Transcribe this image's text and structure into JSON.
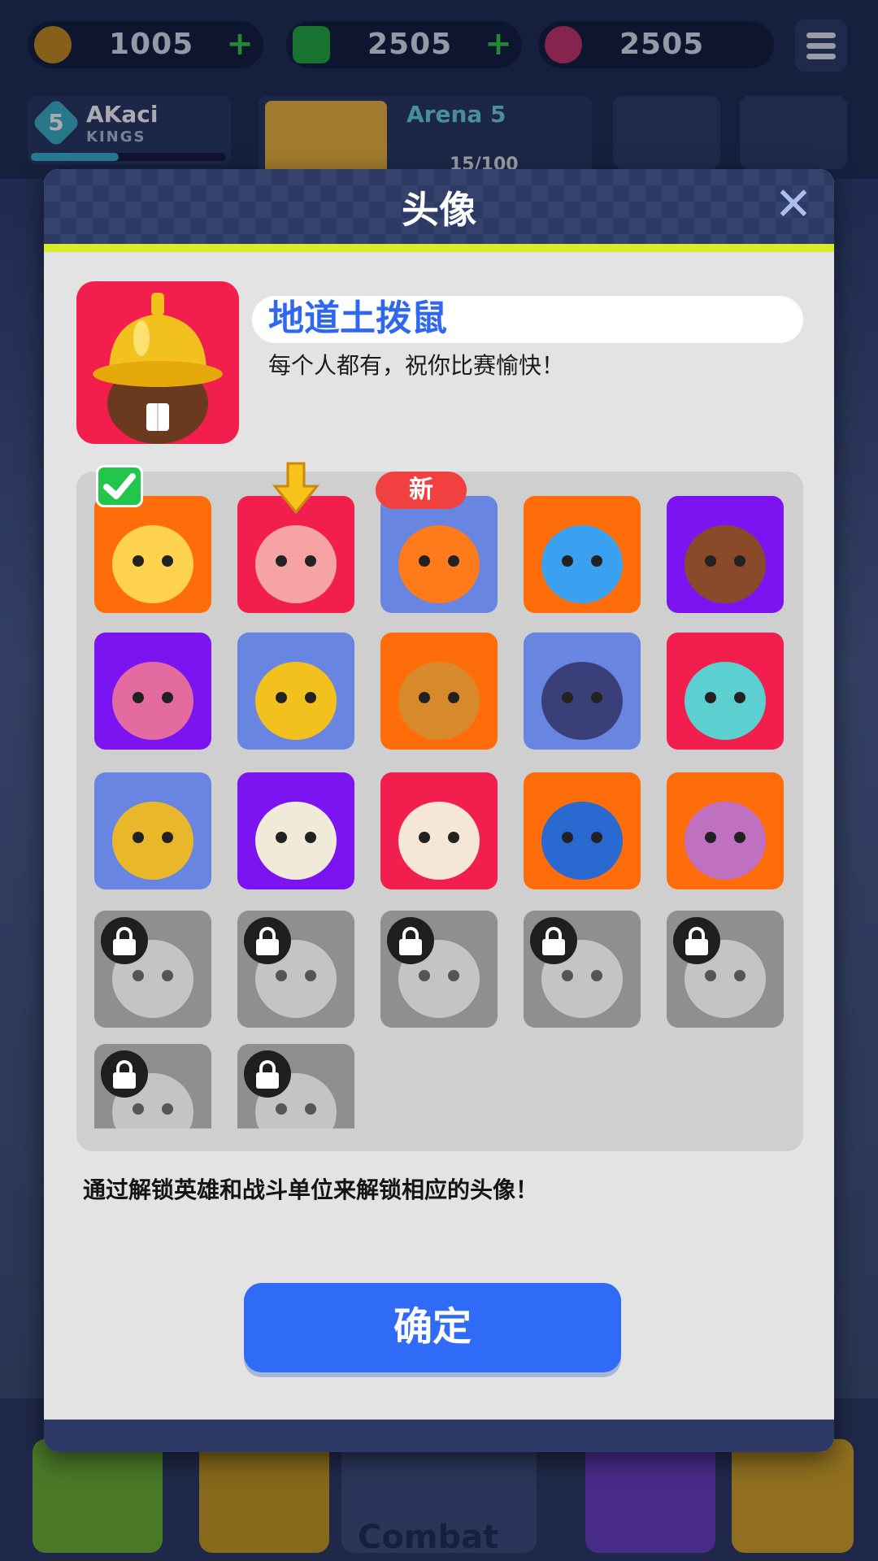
{
  "resources": {
    "coins": "1005",
    "gems": "2505",
    "tokens": "2505",
    "coin_icon": "coin-icon",
    "gem_icon": "gem-icon",
    "token_icon": "flower-token-icon"
  },
  "player": {
    "level": "5",
    "name": "AKaci",
    "subtitle": "KINGS",
    "xp_fraction": 0.45
  },
  "arena": {
    "title": "Arena 5",
    "progress": "15/100"
  },
  "bottom_nav": {
    "combat_label": "Combat"
  },
  "modal": {
    "title": "头像",
    "close_icon": "close-icon",
    "selected_name": "地道土拨鼠",
    "selected_subtitle": "每个人都有，祝你比赛愉快！",
    "new_badge": "新",
    "hint": "通过解锁英雄和战斗单位来解锁相应的头像！",
    "confirm_label": "确定",
    "colors": {
      "orange": "#ff6d0b",
      "pink": "#f11e4e",
      "blue": "#6785e1",
      "purple": "#7c14f1",
      "locked": "#8f8f8f",
      "accent": "#d9ec2a",
      "button": "#2f6bf6"
    },
    "avatars": [
      {
        "icon": "eagle-avatar-icon",
        "bg": "orange",
        "state": "equipped"
      },
      {
        "icon": "pig-pilot-avatar-icon",
        "bg": "pink",
        "state": "highlighted"
      },
      {
        "icon": "fox-avatar-icon",
        "bg": "blue",
        "state": "new"
      },
      {
        "icon": "blue-hat-avatar-icon",
        "bg": "orange",
        "state": "unlocked"
      },
      {
        "icon": "doberman-avatar-icon",
        "bg": "purple",
        "state": "unlocked"
      },
      {
        "icon": "pink-bunny-avatar-icon",
        "bg": "purple",
        "state": "unlocked"
      },
      {
        "icon": "chick-helmet-avatar-icon",
        "bg": "blue",
        "state": "unlocked"
      },
      {
        "icon": "lion-avatar-icon",
        "bg": "orange",
        "state": "unlocked"
      },
      {
        "icon": "cat-robot-avatar-icon",
        "bg": "blue",
        "state": "unlocked"
      },
      {
        "icon": "shark-avatar-icon",
        "bg": "pink",
        "state": "unlocked"
      },
      {
        "icon": "gold-knight-avatar-icon",
        "bg": "blue",
        "state": "unlocked"
      },
      {
        "icon": "walrus-avatar-icon",
        "bg": "purple",
        "state": "unlocked"
      },
      {
        "icon": "cloud-hat-avatar-icon",
        "bg": "pink",
        "state": "unlocked"
      },
      {
        "icon": "blue-mouse-avatar-icon",
        "bg": "orange",
        "state": "unlocked"
      },
      {
        "icon": "goggle-monster-avatar-icon",
        "bg": "orange",
        "state": "unlocked"
      },
      {
        "icon": "masked-bird-avatar-icon",
        "bg": "locked",
        "state": "locked"
      },
      {
        "icon": "crow-avatar-icon",
        "bg": "locked",
        "state": "locked"
      },
      {
        "icon": "robot-walrus-avatar-icon",
        "bg": "locked",
        "state": "locked"
      },
      {
        "icon": "cowboy-bull-avatar-icon",
        "bg": "locked",
        "state": "locked"
      },
      {
        "icon": "top-hat-mouse-avatar-icon",
        "bg": "locked",
        "state": "locked"
      },
      {
        "icon": "sunglasses-avatar-icon",
        "bg": "locked",
        "state": "locked"
      },
      {
        "icon": "horned-knight-avatar-icon",
        "bg": "locked",
        "state": "locked"
      }
    ]
  }
}
